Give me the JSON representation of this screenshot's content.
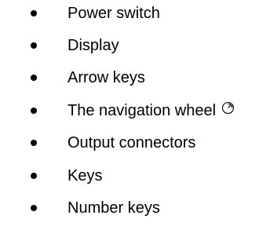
{
  "items": [
    {
      "label": "Power switch"
    },
    {
      "label": "Display"
    },
    {
      "label": "Arrow keys"
    },
    {
      "label": "The navigation wheel",
      "icon": "navigation-wheel-icon"
    },
    {
      "label": "Output connectors"
    },
    {
      "label": "Keys"
    },
    {
      "label": "Number keys"
    }
  ]
}
